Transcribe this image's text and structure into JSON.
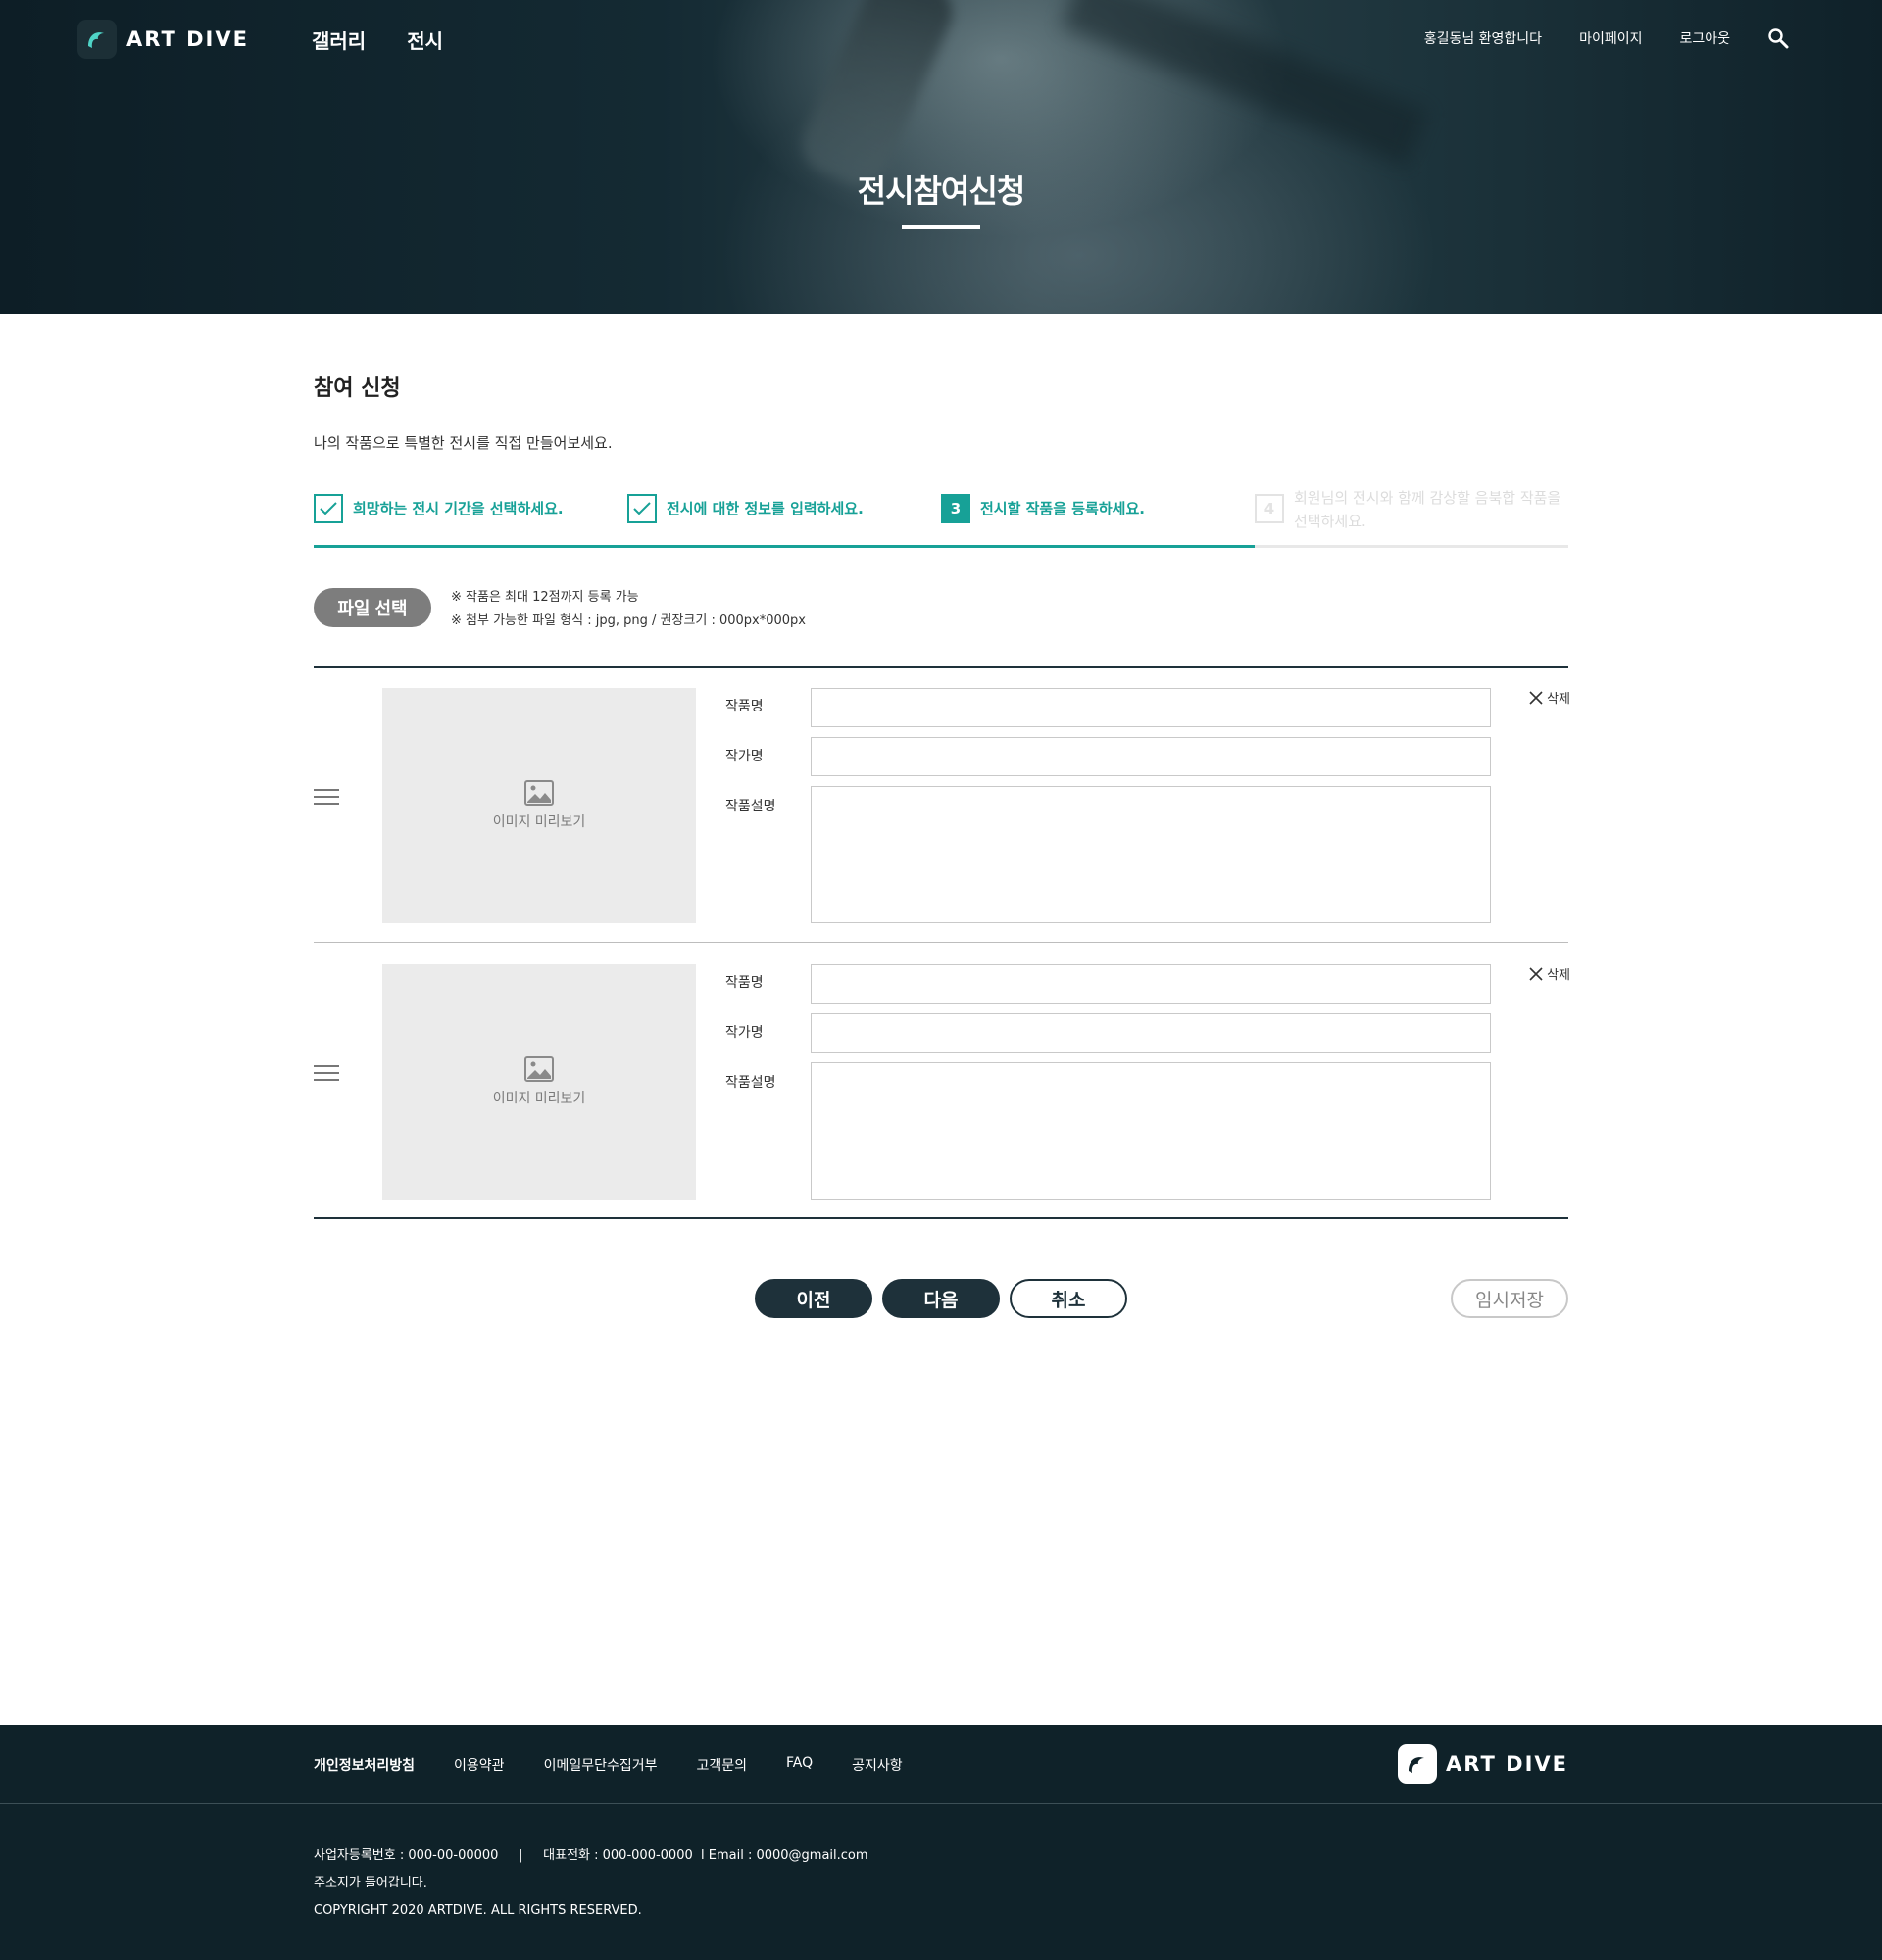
{
  "header": {
    "logo_text": "ART DIVE",
    "nav": [
      "갤러리",
      "전시"
    ],
    "welcome": "홍길동님 환영합니다",
    "mypage": "마이페이지",
    "logout": "로그아웃",
    "search_icon": "search-icon"
  },
  "hero": {
    "title": "전시참여신청"
  },
  "section": {
    "title": "참여 신청",
    "description": "나의 작품으로 특별한 전시를 직접 만들어보세요."
  },
  "steps": {
    "items": [
      {
        "marker": "check",
        "label": "희망하는 전시 기간을 선택하세요.",
        "state": "done"
      },
      {
        "marker": "check",
        "label": "전시에 대한 정보를 입력하세요.",
        "state": "done"
      },
      {
        "marker": "3",
        "label": "전시할 작품을 등록하세요.",
        "state": "current"
      },
      {
        "marker": "4",
        "label": "회원님의 전시와 함께 감상할 음북합 작품을 선택하세요.",
        "state": "todo"
      }
    ],
    "progress_fraction": 0.75
  },
  "upload": {
    "button_label": "파일 선택",
    "note_1": "※ 작품은 최대 12점까지 등록 가능",
    "note_2": "※ 첨부 가능한 파일 형식 : jpg, png / 권장크기 : 000px*000px"
  },
  "artworks": [
    {
      "preview_label": "이미지 미리보기",
      "title_label": "작품명",
      "author_label": "작가명",
      "desc_label": "작품설명",
      "title_value": "",
      "author_value": "",
      "desc_value": "",
      "delete_label": "삭제"
    },
    {
      "preview_label": "이미지 미리보기",
      "title_label": "작품명",
      "author_label": "작가명",
      "desc_label": "작품설명",
      "title_value": "",
      "author_value": "",
      "desc_value": "",
      "delete_label": "삭제"
    }
  ],
  "actions": {
    "prev": "이전",
    "next": "다음",
    "cancel": "취소",
    "temp_save": "임시저장"
  },
  "footer": {
    "links": [
      "개인정보처리방침",
      "이용약관",
      "이메일무단수집거부",
      "고객문의",
      "FAQ",
      "공지사항"
    ],
    "logo_text": "ART DIVE",
    "business_line": "사업자등록번호 : 000-00-00000     |     대표전화 : 000-000-0000  l Email : 0000@gmail.com",
    "address": "주소지가 들어갑니다.",
    "copyright": "COPYRIGHT 2020 ARTDIVE. ALL RIGHTS RESERVED."
  },
  "colors": {
    "accent": "#17a197",
    "dark": "#1e313a",
    "footer_bg": "#0f2229",
    "muted_button": "#7d7d7d"
  }
}
